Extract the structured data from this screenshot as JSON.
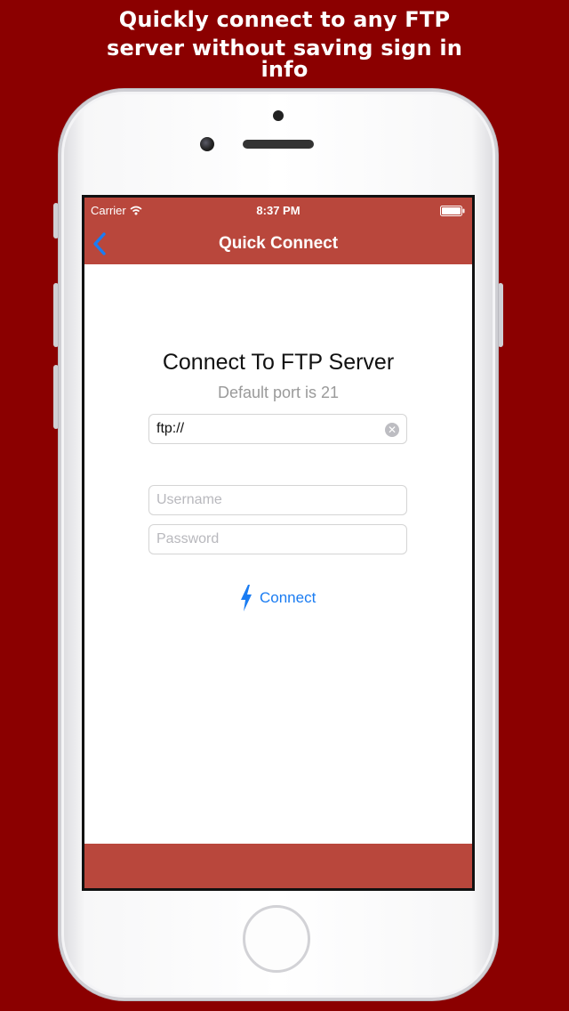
{
  "promo": {
    "line1": "Quickly connect to any FTP",
    "line2": "server without saving sign in",
    "line3": "info"
  },
  "status_bar": {
    "carrier": "Carrier",
    "time": "8:37 PM",
    "icons": [
      "wifi-icon",
      "battery-icon"
    ]
  },
  "nav": {
    "back_icon": "chevron-left-icon",
    "title": "Quick Connect"
  },
  "form": {
    "heading": "Connect To FTP Server",
    "subheading": "Default port is 21",
    "url_value": "ftp://",
    "url_clear_icon": "clear-circle-icon",
    "username_placeholder": "Username",
    "password_placeholder": "Password",
    "connect_label": "Connect",
    "connect_icon": "lightning-bolt-icon"
  },
  "colors": {
    "page_background": "#8b0000",
    "bar_background": "#b9473c",
    "accent_blue": "#1a7cf2",
    "subheading_gray": "#9a9a9a"
  }
}
